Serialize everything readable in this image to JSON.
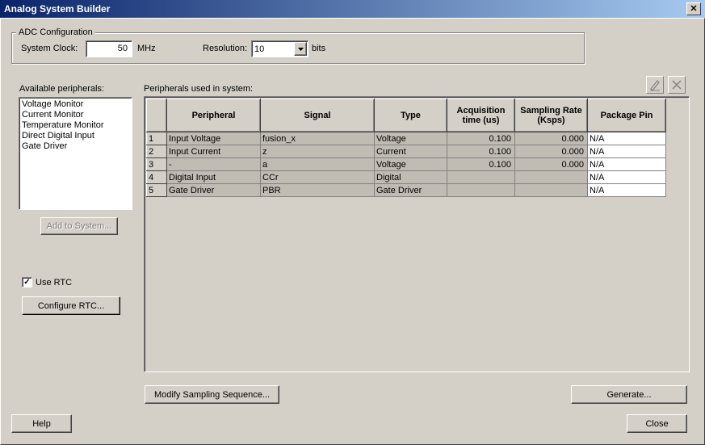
{
  "window": {
    "title": "Analog System Builder",
    "close_glyph": "✕"
  },
  "adc": {
    "group_title": "ADC Configuration",
    "clock_label": "System Clock:",
    "clock_value": "50",
    "clock_unit": "MHz",
    "resolution_label": "Resolution:",
    "resolution_value": "10",
    "resolution_unit": "bits"
  },
  "available": {
    "label": "Available peripherals:",
    "items": [
      "Voltage Monitor",
      "Current Monitor",
      "Temperature Monitor",
      "Direct Digital Input",
      "Gate Driver"
    ],
    "add_button": "Add to System..."
  },
  "rtc": {
    "checkbox_label": "Use RTC",
    "checked": true,
    "configure_button": "Configure RTC..."
  },
  "used": {
    "label": "Peripherals used in system:",
    "columns": [
      "Peripheral",
      "Signal",
      "Type",
      "Acquisition time (us)",
      "Sampling Rate (Ksps)",
      "Package Pin"
    ],
    "rows": [
      {
        "n": "1",
        "peripheral": "Input Voltage",
        "signal": "fusion_x",
        "type": "Voltage",
        "acq": "0.100",
        "rate": "0.000",
        "pin": "N/A"
      },
      {
        "n": "2",
        "peripheral": "Input Current",
        "signal": "z",
        "type": "Current",
        "acq": "0.100",
        "rate": "0.000",
        "pin": "N/A"
      },
      {
        "n": "3",
        "peripheral": "-",
        "signal": "a",
        "type": "Voltage",
        "acq": "0.100",
        "rate": "0.000",
        "pin": "N/A"
      },
      {
        "n": "4",
        "peripheral": "Digital Input",
        "signal": "CCr",
        "type": "Digital",
        "acq": "",
        "rate": "",
        "pin": "N/A"
      },
      {
        "n": "5",
        "peripheral": "Gate Driver",
        "signal": "PBR",
        "type": "Gate Driver",
        "acq": "",
        "rate": "",
        "pin": "N/A"
      }
    ]
  },
  "buttons": {
    "modify": "Modify Sampling Sequence...",
    "generate": "Generate...",
    "help": "Help",
    "close": "Close"
  },
  "icons": {
    "edit": "pencil-icon",
    "delete": "delete-x-icon",
    "dropdown": "dropdown-arrow-icon"
  }
}
